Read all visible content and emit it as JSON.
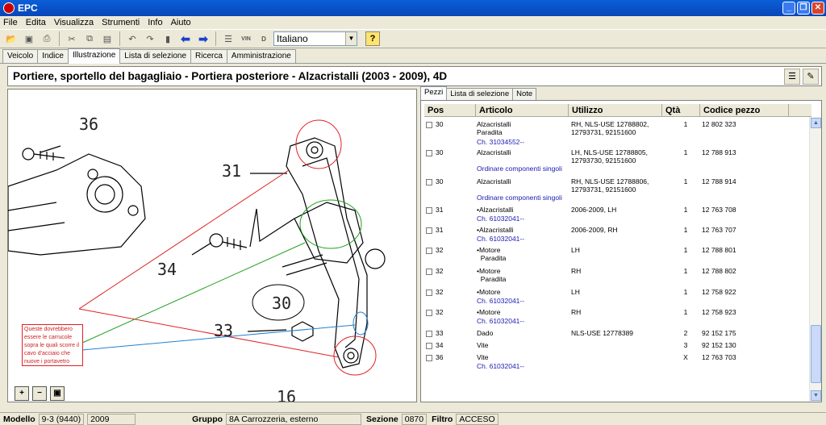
{
  "window": {
    "title": "EPC"
  },
  "menu": [
    "File",
    "Edita",
    "Visualizza",
    "Strumenti",
    "Info",
    "Aiuto"
  ],
  "toolbar": {
    "language": "Italiano",
    "vin_label": "VIN",
    "help_label": "?"
  },
  "tabs": [
    "Veicolo",
    "Indice",
    "Illustrazione",
    "Lista di selezione",
    "Ricerca",
    "Amministrazione"
  ],
  "active_tab": "Illustrazione",
  "header": {
    "title": "Portiere, sportello del bagagliaio - Portiera posteriore - Alzacristalli   (2003 - 2009), 4D"
  },
  "illustration": {
    "callouts": [
      "36",
      "31",
      "34",
      "30",
      "33",
      "16"
    ],
    "note_lines": [
      "Queste dovrebbero",
      "essere le carrucole",
      "sopra le quali scorre il",
      "cavo d'acciaio che",
      "nuove i portavetro"
    ]
  },
  "part_tabs": [
    "Pezzi",
    "Lista di selezione",
    "Note"
  ],
  "table": {
    "columns": [
      "Pos",
      "Articolo",
      "Utilizzo",
      "Qtà",
      "Codice pezzo"
    ],
    "rows": [
      {
        "pos": "30",
        "art": "Alzacristalli",
        "art2": "Paradita",
        "uti": "RH, NLS-USE 12788802,",
        "uti2": "12793731, 92151600",
        "qta": "1",
        "cod": "12 802 323",
        "sub": "Ch. 31034552--"
      },
      {
        "pos": "30",
        "art": "Alzacristalli",
        "art2": "",
        "uti": "LH, NLS-USE 12788805,",
        "uti2": "12793730, 92151600",
        "qta": "1",
        "cod": "12 788 913",
        "sub": "Ordinare componenti singoli"
      },
      {
        "pos": "30",
        "art": "Alzacristalli",
        "art2": "",
        "uti": "RH, NLS-USE 12788806,",
        "uti2": "12793731, 92151600",
        "qta": "1",
        "cod": "12 788 914",
        "sub": "Ordinare componenti singoli"
      },
      {
        "pos": "31",
        "art": "•Alzacristalli",
        "art2": "",
        "uti": "2006-2009,  LH",
        "uti2": "",
        "qta": "1",
        "cod": "12 763 708",
        "sub": "Ch. 61032041--"
      },
      {
        "pos": "31",
        "art": "•Alzacristalli",
        "art2": "",
        "uti": "2006-2009,  RH",
        "uti2": "",
        "qta": "1",
        "cod": "12 763 707",
        "sub": "Ch. 61032041--"
      },
      {
        "pos": "32",
        "art": "•Motore",
        "art2": "Paradita",
        "uti": "LH",
        "uti2": "",
        "qta": "1",
        "cod": "12 788 801",
        "sub": ""
      },
      {
        "pos": "32",
        "art": "•Motore",
        "art2": "Paradita",
        "uti": "RH",
        "uti2": "",
        "qta": "1",
        "cod": "12 788 802",
        "sub": ""
      },
      {
        "pos": "32",
        "art": "•Motore",
        "art2": "",
        "uti": "LH",
        "uti2": "",
        "qta": "1",
        "cod": "12 758 922",
        "sub": "Ch. 61032041--"
      },
      {
        "pos": "32",
        "art": "•Motore",
        "art2": "",
        "uti": "RH",
        "uti2": "",
        "qta": "1",
        "cod": "12 758 923",
        "sub": "Ch. 61032041--"
      },
      {
        "pos": "33",
        "art": "Dado",
        "art2": "",
        "uti": "NLS-USE 12778389",
        "uti2": "",
        "qta": "2",
        "cod": "92 152 175",
        "sub": ""
      },
      {
        "pos": "34",
        "art": "Vite",
        "art2": "",
        "uti": "",
        "uti2": "",
        "qta": "3",
        "cod": "92 152 130",
        "sub": ""
      },
      {
        "pos": "36",
        "art": "Vite",
        "art2": "",
        "uti": "",
        "uti2": "",
        "qta": "X",
        "cod": "12 763 703",
        "sub": "Ch. 61032041--"
      }
    ]
  },
  "status": {
    "modello_label": "Modello",
    "modello": "9-3 (9440)",
    "anno": "2009",
    "gruppo_label": "Gruppo",
    "gruppo": "8A Carrozzeria, esterno",
    "sezione_label": "Sezione",
    "sezione": "0870",
    "filtro_label": "Filtro",
    "filtro": "ACCESO"
  }
}
